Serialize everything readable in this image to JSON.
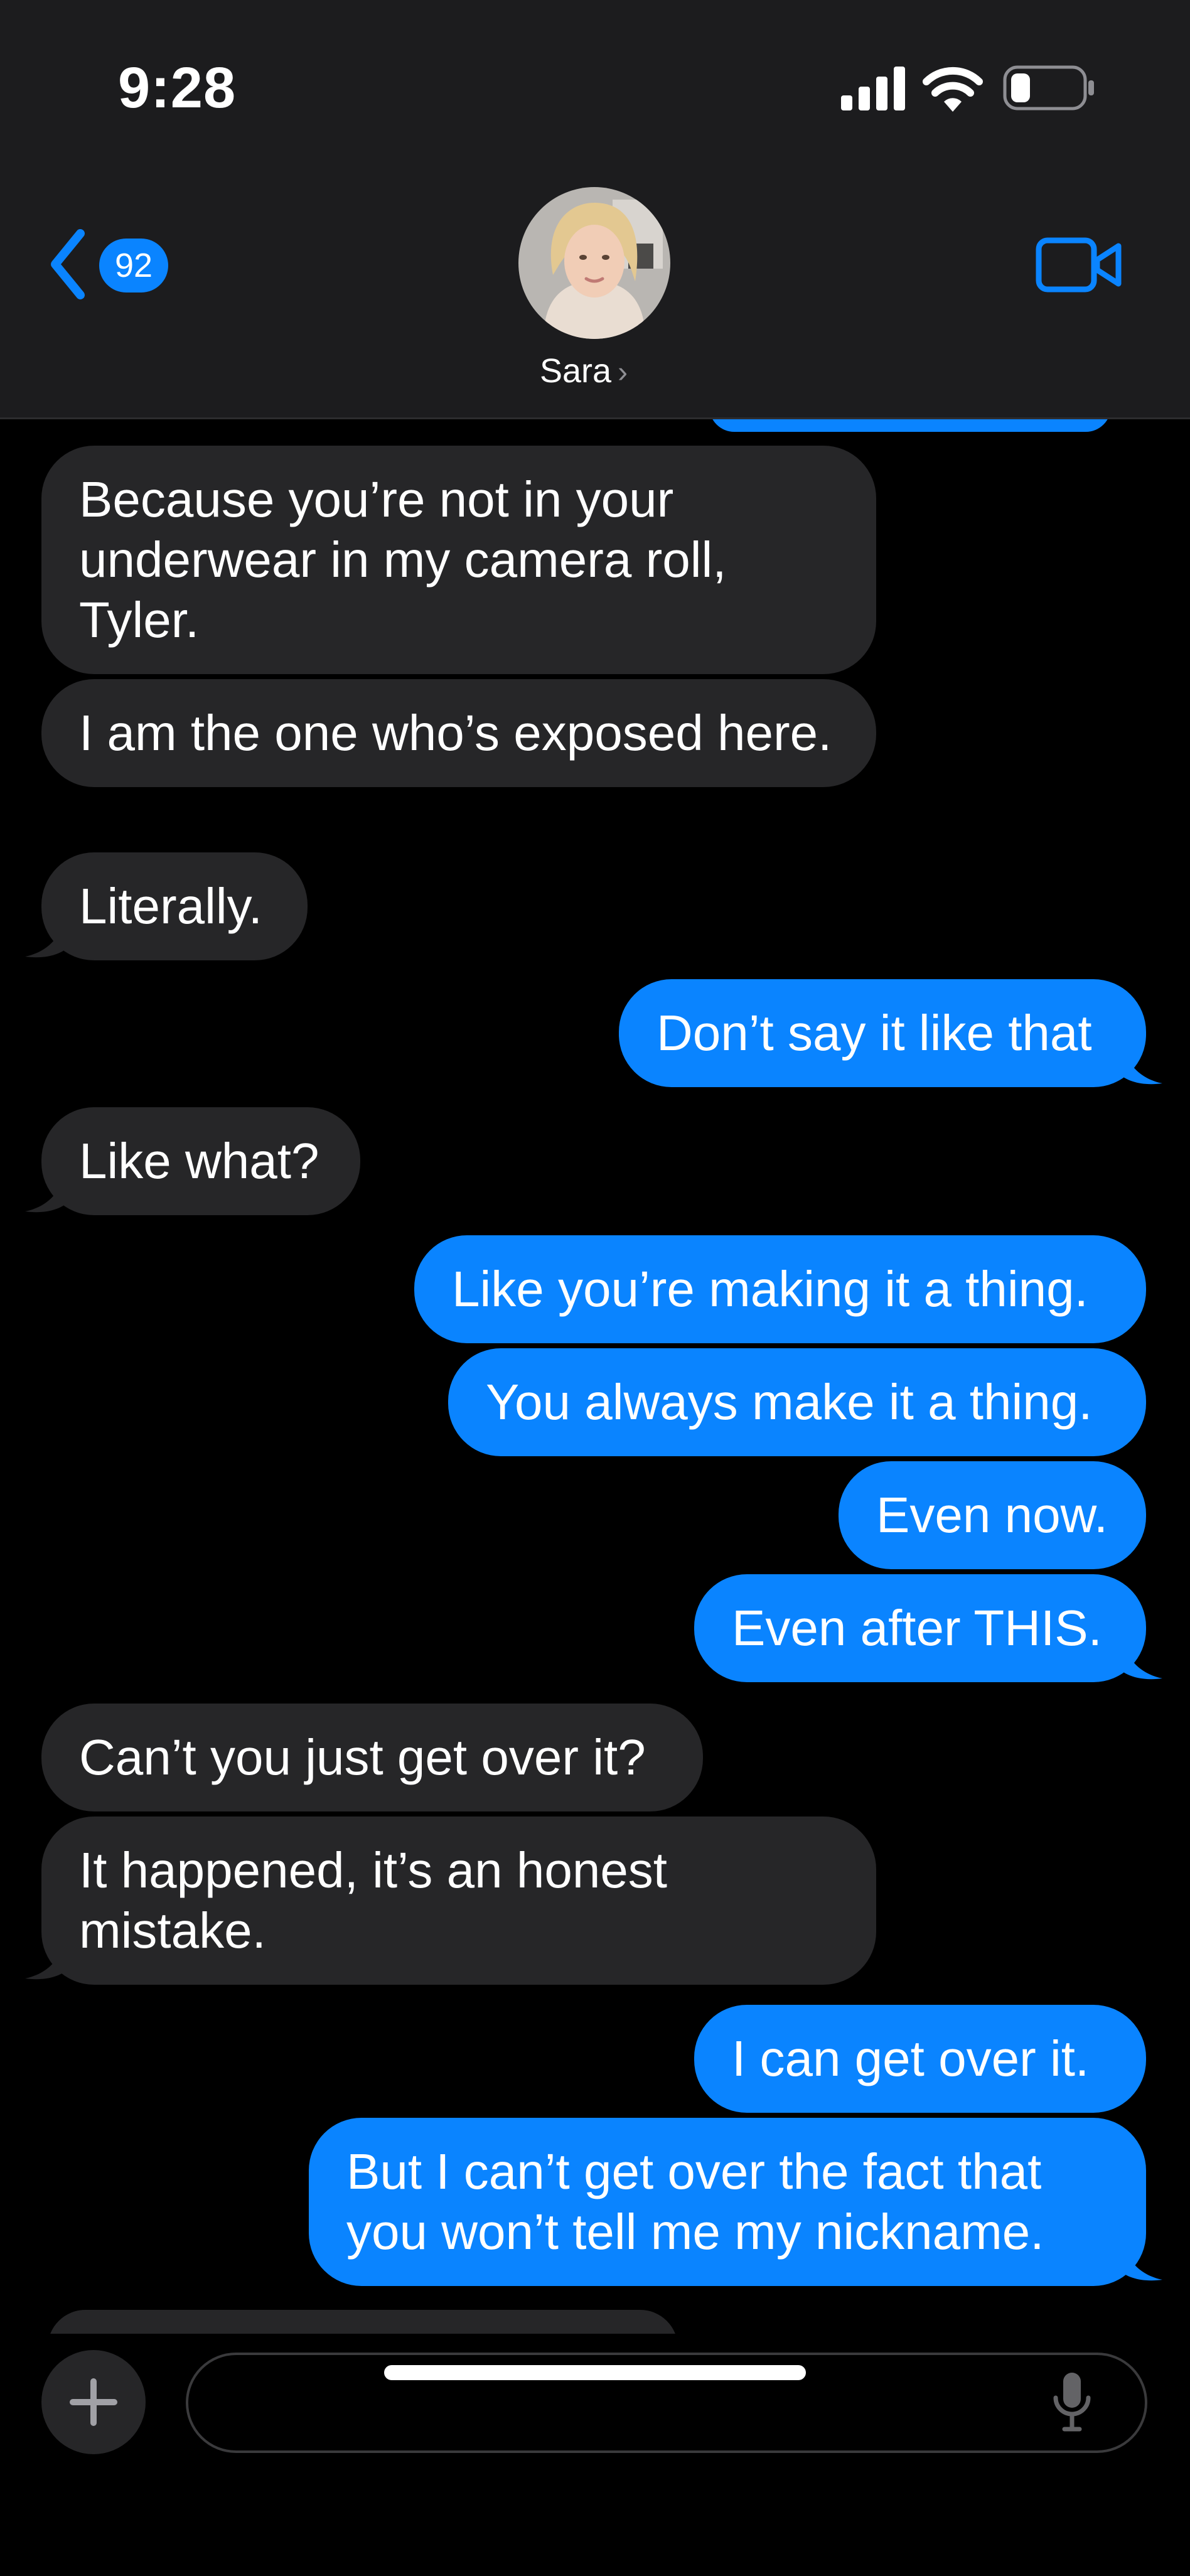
{
  "status_bar": {
    "time": "9:28"
  },
  "header": {
    "back_badge_count": "92",
    "contact_name": "Sara",
    "contact_chevron": "›"
  },
  "messages": [
    {
      "side": "in",
      "text": "Because you’re not in your underwear in my camera roll, Tyler."
    },
    {
      "side": "in",
      "text": "I am the one who’s exposed here."
    },
    {
      "side": "in",
      "text": "Literally."
    },
    {
      "side": "out",
      "text": "Don’t say it like that"
    },
    {
      "side": "in",
      "text": "Like what?"
    },
    {
      "side": "out",
      "text": "Like you’re making it a thing."
    },
    {
      "side": "out",
      "text": "You always make it a thing."
    },
    {
      "side": "out",
      "text": "Even now."
    },
    {
      "side": "out",
      "text": "Even after THIS."
    },
    {
      "side": "in",
      "text": "Can’t you just get over it?"
    },
    {
      "side": "in",
      "text": "It happened, it’s an honest mistake."
    },
    {
      "side": "out",
      "text": "I can get over it."
    },
    {
      "side": "out",
      "text": "But I can’t get over the fact that you won’t tell me my nickname."
    }
  ],
  "compose": {
    "placeholder": ""
  },
  "colors": {
    "accent": "#0a84ff",
    "incoming_bubble": "#262628",
    "header_bg": "#1c1c1e"
  },
  "icons": {
    "back": "chevron-left-icon",
    "video": "video-camera-icon",
    "plus": "plus-icon",
    "mic": "microphone-icon",
    "signal": "cellular-signal-icon",
    "wifi": "wifi-icon",
    "battery": "battery-icon"
  }
}
